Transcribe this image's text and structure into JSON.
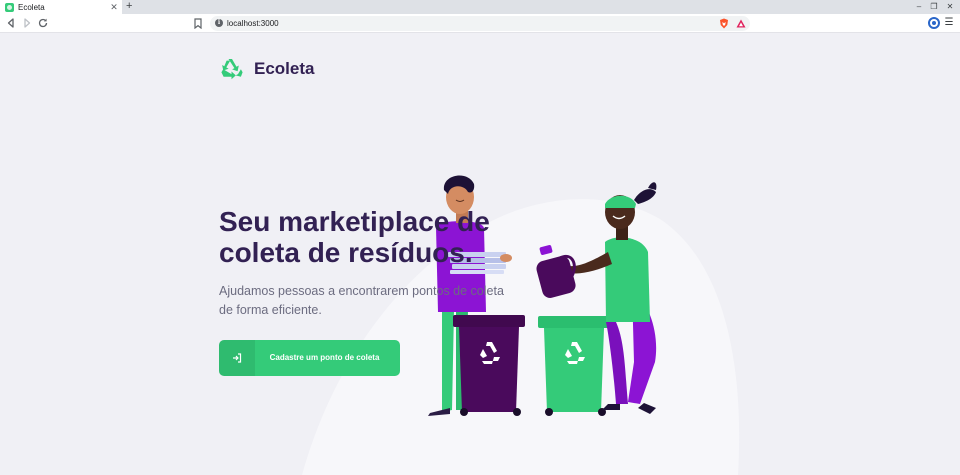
{
  "browser": {
    "tab": {
      "title": "Ecoleta"
    },
    "address": {
      "url": "localhost:3000"
    }
  },
  "app": {
    "logo_text": "Ecoleta",
    "hero": {
      "title": "Seu marketiplace de coleta de resíduos.",
      "description": "Ajudamos pessoas a encontrarem pontos de coleta de forma eficiente."
    },
    "cta": {
      "label": "Cadastre um ponto de coleta"
    }
  },
  "colors": {
    "brand_green": "#34CB79",
    "title_purple": "#322153",
    "text_gray": "#6C6C80",
    "page_bg": "#F0F0F5",
    "bin_purple": "#4A0A5C"
  },
  "icons": {
    "logo": "recycle-icon",
    "cta": "log-in-icon"
  }
}
